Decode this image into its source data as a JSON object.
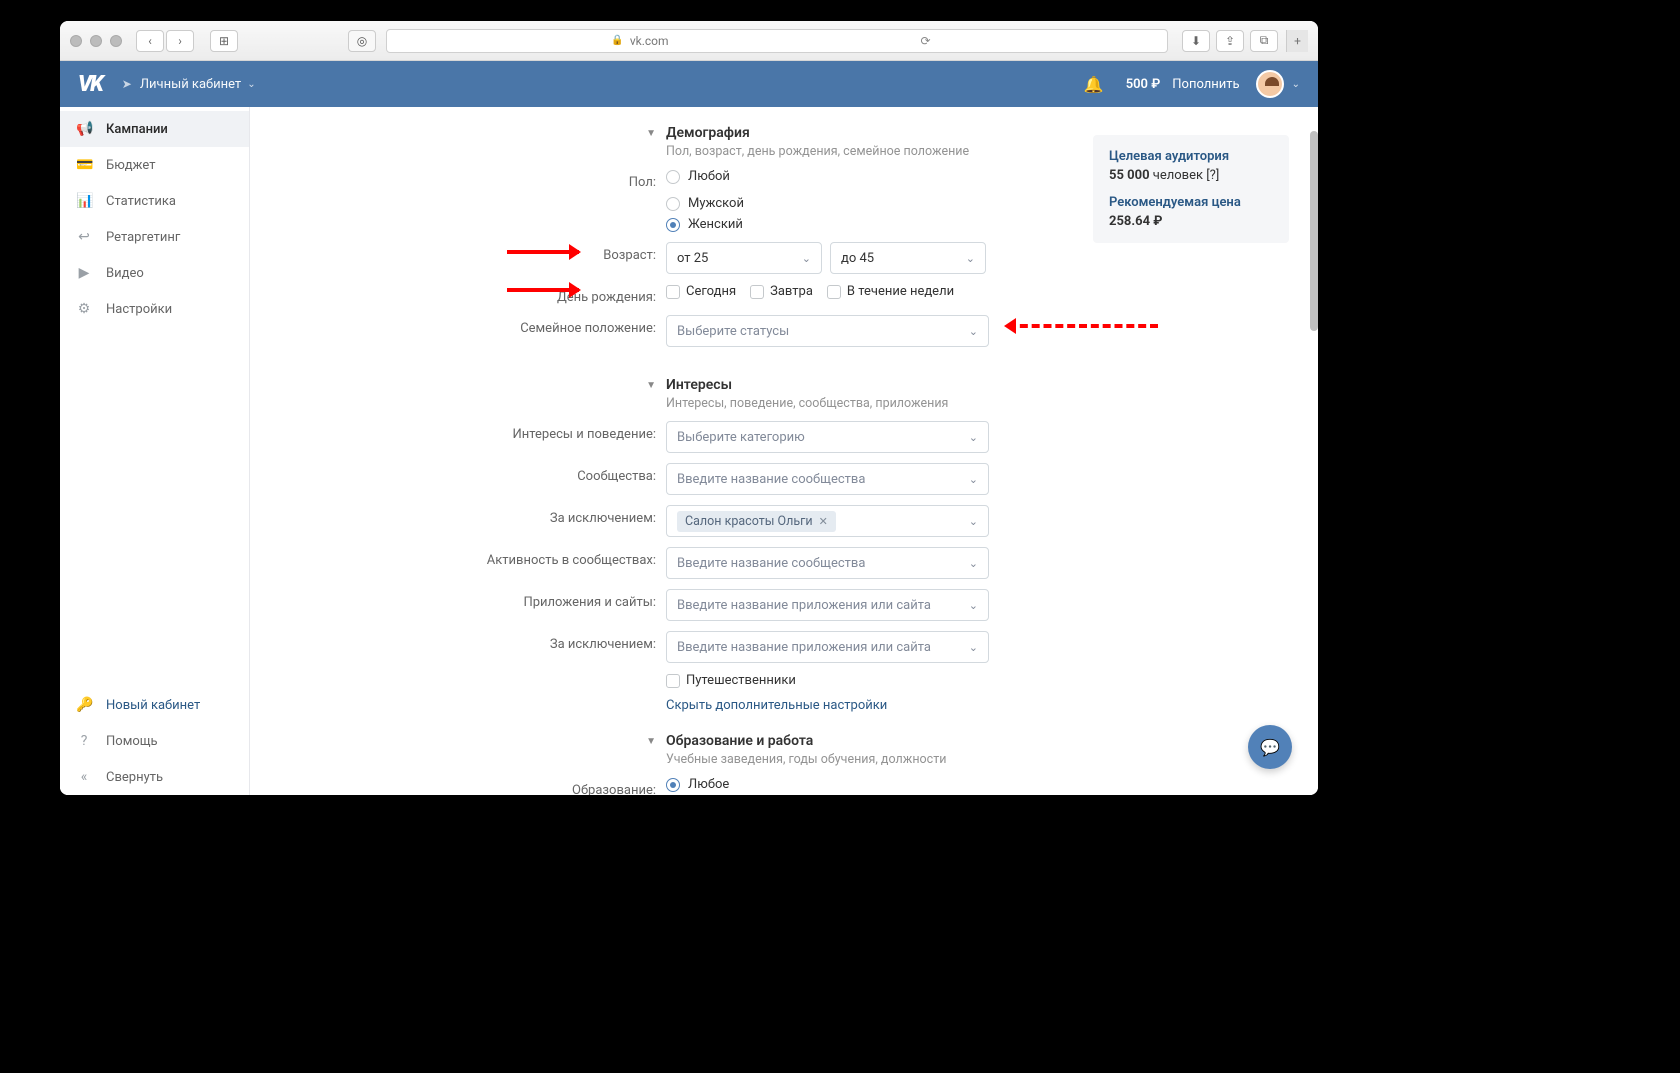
{
  "browser": {
    "url_host": "vk.com"
  },
  "header": {
    "account_label": "Личный кабинет",
    "balance": "500 ₽",
    "topup": "Пополнить"
  },
  "sidebar": {
    "items": [
      {
        "label": "Кампании"
      },
      {
        "label": "Бюджет"
      },
      {
        "label": "Статистика"
      },
      {
        "label": "Ретаргетинг"
      },
      {
        "label": "Видео"
      },
      {
        "label": "Настройки"
      }
    ],
    "new_cabinet": "Новый кабинет",
    "help": "Помощь",
    "collapse": "Свернуть"
  },
  "summary": {
    "audience_title": "Целевая аудитория",
    "audience_count": "55 000",
    "audience_unit": "человек [?]",
    "price_title": "Рекомендуемая цена",
    "price_value": "258.64 ₽"
  },
  "demography": {
    "title": "Демография",
    "subtitle": "Пол, возраст, день рождения, семейное положение",
    "gender_label": "Пол:",
    "gender_options": {
      "any": "Любой",
      "male": "Мужской",
      "female": "Женский"
    },
    "age_label": "Возраст:",
    "age_from": "от 25",
    "age_to": "до 45",
    "birthday_label": "День рождения:",
    "birthday_options": {
      "today": "Сегодня",
      "tomorrow": "Завтра",
      "week": "В течение недели"
    },
    "family_label": "Семейное положение:",
    "family_placeholder": "Выберите статусы"
  },
  "interests": {
    "title": "Интересы",
    "subtitle": "Интересы, поведение, сообщества, приложения",
    "behavior_label": "Интересы и поведение:",
    "behavior_placeholder": "Выберите категорию",
    "communities_label": "Сообщества:",
    "communities_placeholder": "Введите название сообщества",
    "except_label": "За исключением:",
    "except_tag": "Салон красоты Ольги",
    "activity_label": "Активность в сообществах:",
    "apps_label": "Приложения и сайты:",
    "apps_placeholder": "Введите название приложения или сайта",
    "except2_label": "За исключением:",
    "travelers": "Путешественники",
    "hide_link": "Скрыть дополнительные настройки"
  },
  "education": {
    "title": "Образование и работа",
    "subtitle": "Учебные заведения, годы обучения, должности",
    "edu_label": "Образование:",
    "edu_any": "Любое"
  }
}
